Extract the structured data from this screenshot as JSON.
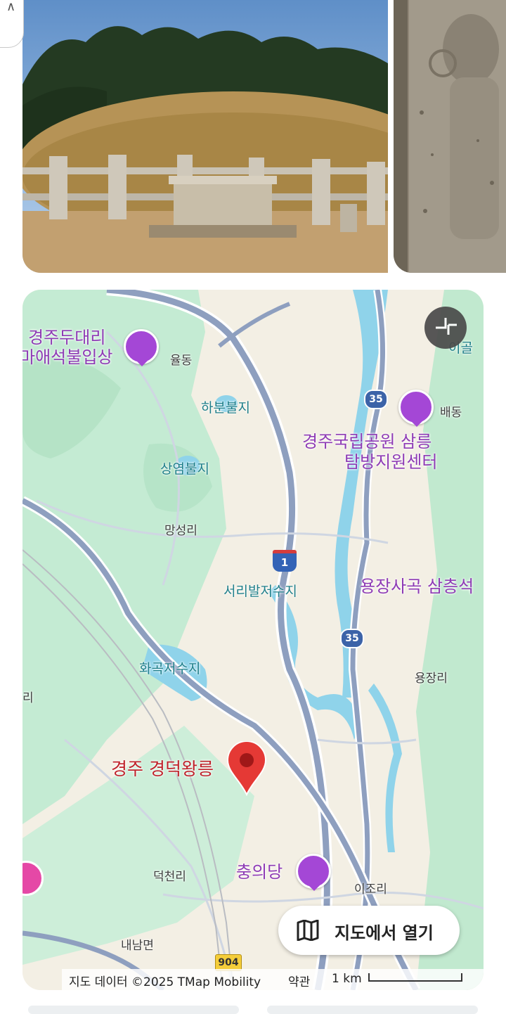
{
  "photos": [
    {
      "name": "경덕왕릉 tomb mound",
      "kind": "photo"
    },
    {
      "name": "stone carving relief",
      "kind": "photo"
    }
  ],
  "map": {
    "labels": {
      "poi_duedae_line1": "경주두대리",
      "poi_duedae_line2": "마애석불입상",
      "village_yuldong": "율동",
      "village_igol": "이골",
      "lake_habun": "하분불지",
      "village_baedong": "배동",
      "park_line1": "경주국립공원 삼릉",
      "park_line2": "탐방지원센터",
      "lake_sangyeom": "상염불지",
      "village_mangseong": "망성리",
      "lake_seoribal": "서리발저수지",
      "poi_yongjang": "용장사곡 삼층석",
      "lake_hwagok": "화곡저수지",
      "village_yongjang": "용장리",
      "village_ri": "리",
      "pin_label": "경주 경덕왕릉",
      "village_deokcheon": "덕천리",
      "poi_chungui": "충의당",
      "village_ijo": "이조리",
      "village_naenam": "내남면"
    },
    "road_shields": {
      "highway": "1",
      "road_35_a": "35",
      "road_35_b": "35",
      "road_904": "904"
    },
    "open_button_label": "지도에서 열기",
    "attribution": {
      "data": "지도 데이터 ©2025 TMap Mobility",
      "terms": "약관",
      "scale": "1 km"
    },
    "colors": {
      "land": "#f3efe4",
      "green": "#bfe9cf",
      "water": "#8fd3ea",
      "road": "#8e9fbf",
      "pin": "#e53935",
      "poi_purple": "#a447d6"
    }
  }
}
